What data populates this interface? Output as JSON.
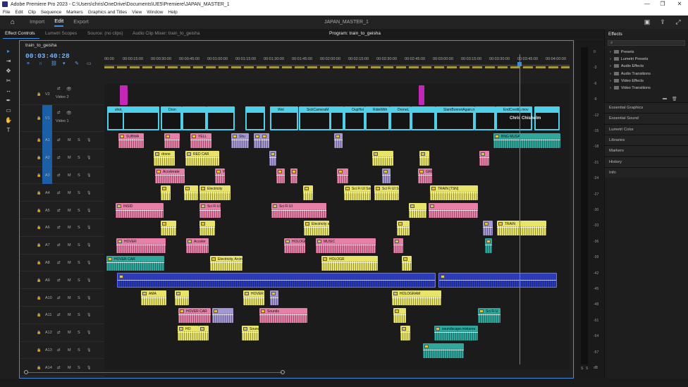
{
  "window": {
    "title": "Adobe Premiere Pro 2023 - C:\\Users\\chris\\OneDrive\\Documents\\UE5\\Premiere\\JAPAN_MASTER_1",
    "controls": [
      "—",
      "❐",
      "✕"
    ]
  },
  "menu": [
    "File",
    "Edit",
    "Clip",
    "Sequence",
    "Markers",
    "Graphics and Titles",
    "View",
    "Window",
    "Help"
  ],
  "workspace": {
    "tabs": [
      "Import",
      "Edit",
      "Export"
    ],
    "active_tab": "Edit",
    "project_title": "JAPAN_MASTER_1"
  },
  "panels": {
    "effect_controls": "Effect Controls",
    "lumetri_scopes": "Lumetri Scopes",
    "source": "Source: (no clips)",
    "audio_mixer": "Audio Clip Mixer: train_to_geisha",
    "program": "Program: train_to_geisha",
    "effects": "Effects"
  },
  "timeline": {
    "sequence_tab": "train_to_geisha",
    "timecode": "00:03:40:28",
    "ruler_labels": [
      "00:00",
      "00:00:15:00",
      "00:00:30:00",
      "00:00:45:00",
      "00:01:00:00",
      "00:01:15:00",
      "00:01:30:00",
      "00:01:45:00",
      "00:02:00:00",
      "00:02:15:00",
      "00:02:30:00",
      "00:02:45:00",
      "00:03:00:00",
      "00:03:15:00",
      "00:03:30:00",
      "00:03:45:00",
      "00:04:00:00"
    ],
    "video_tracks": [
      {
        "id": "V2",
        "name": "Video 2"
      },
      {
        "id": "V1",
        "name": "Video 1"
      }
    ],
    "audio_tracks": [
      "A1",
      "A2",
      "A3",
      "A4",
      "A5",
      "A6",
      "A7",
      "A8",
      "A9",
      "A10",
      "A11",
      "A12",
      "A13",
      "A14"
    ],
    "track_controls": {
      "mute": "M",
      "solo": "S"
    }
  },
  "clips": {
    "v1": [
      "shot_2_train.mov",
      "Dron",
      "Wet",
      "SickCameraM",
      "OupHol",
      "RideWith",
      "DroneL",
      "SlamBonnetAgain.m",
      "EndCredits.mov"
    ],
    "v1_overlay": "Chris Chisholm",
    "audio": [
      "SUBWA",
      "YELL",
      "Shu",
      "Shu",
      "BNG MUSA",
      "drone",
      "RED CAR",
      "Accelerate",
      "Wet",
      "GREEN",
      "Electricity",
      "Sci Fi UI Sou",
      "Sci Fi UI Sounds.wav",
      "TRAIN [TSN]",
      "INSID",
      "Sci Fi UI Sounds.wav",
      "Sci Fi UI",
      "Electricity sound effect.wa",
      "TRAIN",
      "HOVER",
      "Acceler",
      "HOLOGRAM HUM",
      "MUSIC",
      "HOVER CAR",
      "Electricity, Arcing - Continuous",
      "HOLOGR",
      "AMA",
      "HOVER CAR",
      "HOLOGRAM",
      "HOVER CAR",
      "Sounds",
      "Sci Fi U",
      "HO",
      "SoundsClose Earth_pro",
      "soundscape.mixtures"
    ]
  },
  "meter_db": [
    "0",
    "-3",
    "-6",
    "-9",
    "-12",
    "-15",
    "-18",
    "-21",
    "-24",
    "-27",
    "-30",
    "-33",
    "-36",
    "-39",
    "-42",
    "-45",
    "-48",
    "-51",
    "-54",
    "-57",
    "dB"
  ],
  "meter_solo": [
    "S",
    "S"
  ],
  "effects_panel": {
    "search_placeholder": "",
    "folders": [
      "Presets",
      "Lumetri Presets",
      "Audio Effects",
      "Audio Transitions",
      "Video Effects",
      "Video Transitions"
    ],
    "sections": [
      "Essential Graphics",
      "Essential Sound",
      "Lumetri Color",
      "Libraries",
      "Markers",
      "History",
      "Info"
    ]
  },
  "colors": {
    "accent": "#3d8ee0",
    "clip_pink": "#e77fa8",
    "clip_yellow": "#e8e46a",
    "clip_lavender": "#a597d6",
    "clip_teal": "#2fa79c",
    "clip_blue": "#2c3bb8",
    "clip_cyan": "#4fd0e8",
    "clip_magenta": "#c227b6"
  }
}
